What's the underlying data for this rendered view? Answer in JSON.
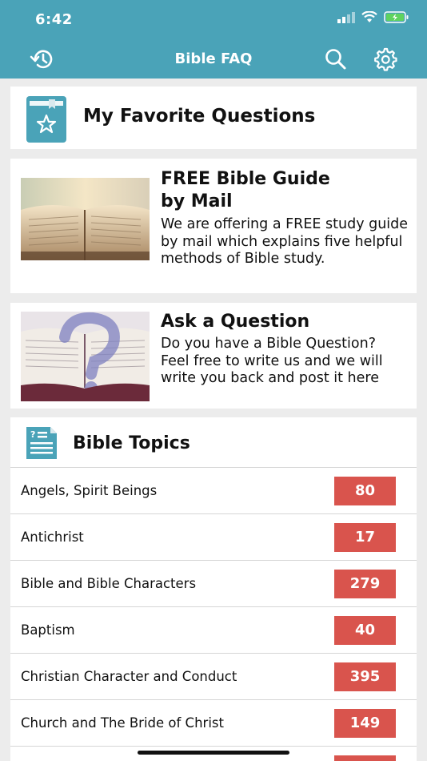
{
  "status_bar": {
    "time": "6:42"
  },
  "nav": {
    "title": "Bible FAQ"
  },
  "favorites": {
    "title": "My Favorite Questions"
  },
  "promos": [
    {
      "title_line1": "FREE Bible Guide",
      "title_line2": "by Mail",
      "body": "We are offering a FREE study guide by mail which explains five helpful methods of Bible study."
    },
    {
      "title": "Ask a Question",
      "body": "Do you have a Bible Question? Feel free to write us and we will write you back and post it here"
    }
  ],
  "topics": {
    "title": "Bible Topics",
    "items": [
      {
        "label": "Angels, Spirit Beings",
        "count": "80"
      },
      {
        "label": "Antichrist",
        "count": "17"
      },
      {
        "label": "Bible and Bible Characters",
        "count": "279"
      },
      {
        "label": "Baptism",
        "count": "40"
      },
      {
        "label": "Christian Character and Conduct",
        "count": "395"
      },
      {
        "label": "Church and The Bride of Christ",
        "count": "149"
      },
      {
        "label": "",
        "count": ""
      }
    ]
  },
  "colors": {
    "header": "#4aa3b8",
    "badge": "#d9544d",
    "icon": "#4aa3b8"
  },
  "icons": {
    "history": "history-icon",
    "search": "search-icon",
    "settings": "gear-icon"
  }
}
